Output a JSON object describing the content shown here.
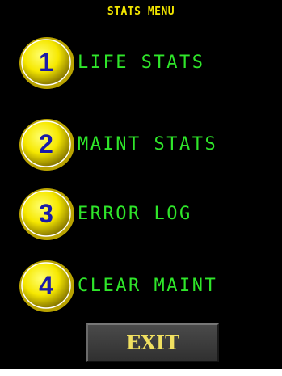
{
  "menu": {
    "title": "STATS MENU",
    "items": [
      {
        "number": "1",
        "label": "LIFE STATS"
      },
      {
        "number": "2",
        "label": "MAINT STATS"
      },
      {
        "number": "3",
        "label": "ERROR LOG"
      },
      {
        "number": "4",
        "label": "CLEAR MAINT"
      }
    ],
    "exit_label": "EXIT"
  },
  "colors": {
    "background": "#000000",
    "title": "#f2e600",
    "label": "#2fe62a",
    "button_yellow": "#f6e800",
    "number": "#1a1aa8"
  }
}
